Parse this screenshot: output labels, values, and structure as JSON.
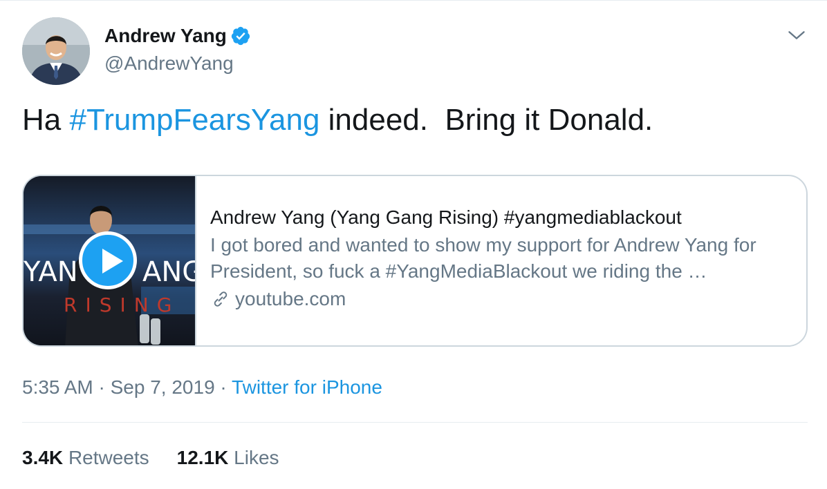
{
  "author": {
    "display_name": "Andrew Yang",
    "handle": "@AndrewYang",
    "verified": true,
    "avatar_icon": "avatar-photo"
  },
  "tweet": {
    "text_before": "Ha ",
    "hashtag": "#TrumpFearsYang",
    "text_after": " indeed.  Bring it Donald."
  },
  "card": {
    "title": "Andrew Yang (Yang Gang Rising) #yangmediablackout",
    "description": "I got bored and wanted to show my support for Andrew Yang for President, so fuck a #YangMediaBlackout we riding the …",
    "domain": "youtube.com",
    "thumbnail_text_left": "YAN",
    "thumbnail_text_right": "ANG",
    "thumbnail_subtext": "RISING"
  },
  "meta": {
    "time": "5:35 AM",
    "separator": " · ",
    "date": "Sep 7, 2019",
    "source": "Twitter for iPhone"
  },
  "stats": {
    "retweets_count": "3.4K",
    "retweets_label": "Retweets",
    "likes_count": "12.1K",
    "likes_label": "Likes"
  },
  "colors": {
    "link_blue": "#1b95e0",
    "verified_blue": "#1da1f2",
    "secondary_text": "#657786",
    "border": "#ccd6dd"
  }
}
